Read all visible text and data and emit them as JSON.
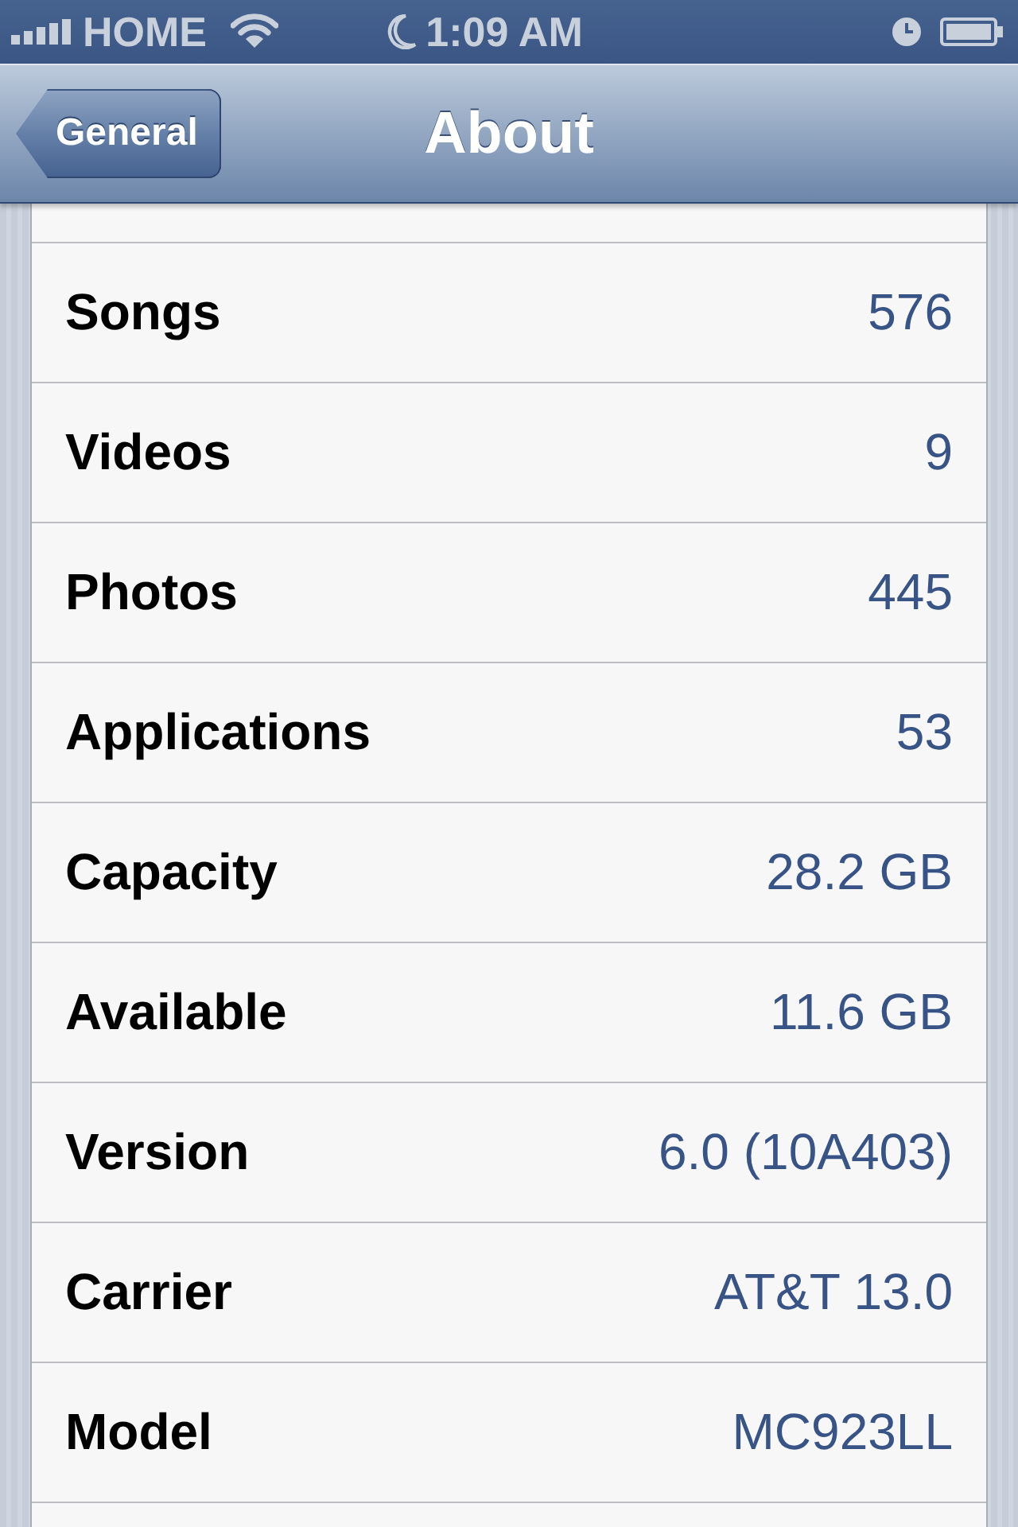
{
  "status_bar": {
    "carrier": "HOME",
    "time": "1:09 AM"
  },
  "nav_bar": {
    "back_button": "General",
    "title": "About"
  },
  "rows": [
    {
      "label": "Songs",
      "value": "576"
    },
    {
      "label": "Videos",
      "value": "9"
    },
    {
      "label": "Photos",
      "value": "445"
    },
    {
      "label": "Applications",
      "value": "53"
    },
    {
      "label": "Capacity",
      "value": "28.2 GB"
    },
    {
      "label": "Available",
      "value": "11.6 GB"
    },
    {
      "label": "Version",
      "value": "6.0 (10A403)"
    },
    {
      "label": "Carrier",
      "value": "AT&T 13.0"
    },
    {
      "label": "Model",
      "value": "MC923LL"
    }
  ]
}
